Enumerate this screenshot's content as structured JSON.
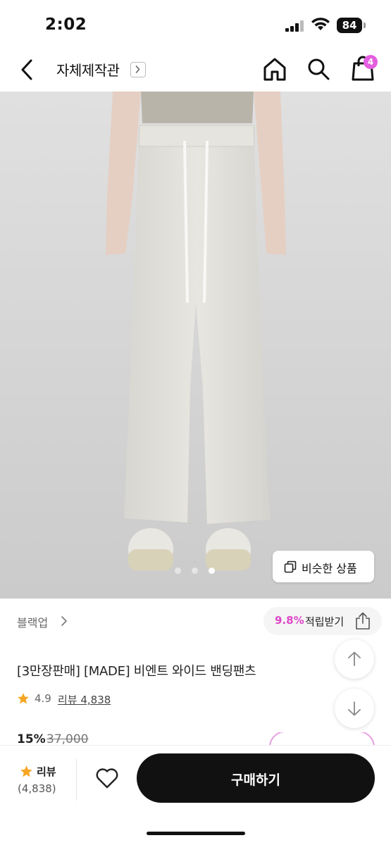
{
  "status_bar": {
    "time": "2:02",
    "battery": "84"
  },
  "nav": {
    "title": "자체제작관",
    "cart_count": "4"
  },
  "hero": {
    "carousel_count": 3,
    "active_index": 2,
    "similar_button": "비슷한 상품"
  },
  "brand": {
    "name": "블랙업",
    "reward_percent": "9.8%",
    "reward_label": "적립받기"
  },
  "product": {
    "name": "[3만장판매] [MADE] 비엔트 와이드 밴딩팬츠",
    "rating": "4.9",
    "review_link": "리뷰 4,838",
    "discount": "15%",
    "original_price": "37,000"
  },
  "bottom_bar": {
    "review_label": "리뷰",
    "review_count": "(4,838)",
    "buy_label": "구매하기"
  },
  "colors": {
    "accent": "#e045c8",
    "badge": "#e45ee0",
    "star": "#f5a623",
    "buy_button": "#111111"
  },
  "icons": [
    "back-icon",
    "home-icon",
    "search-icon",
    "shopping-bag-icon",
    "copy-icon",
    "chevron-right-icon",
    "share-icon",
    "arrow-up-icon",
    "arrow-down-icon",
    "star-icon",
    "heart-icon"
  ]
}
